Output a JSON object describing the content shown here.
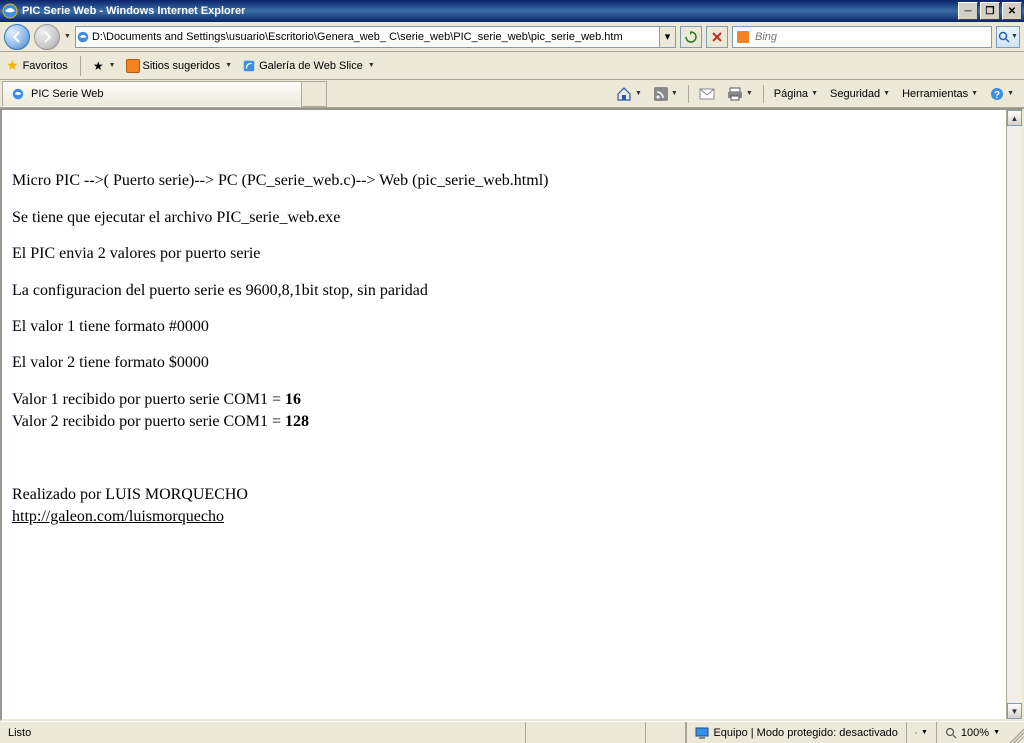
{
  "window": {
    "title": "PIC Serie Web - Windows Internet Explorer"
  },
  "nav": {
    "address": "D:\\Documents and Settings\\usuario\\Escritorio\\Genera_web_ C\\serie_web\\PIC_serie_web\\pic_serie_web.htm",
    "search_placeholder": "Bing"
  },
  "favorites": {
    "label": "Favoritos",
    "suggested": "Sitios sugeridos",
    "webslice": "Galería de Web Slice"
  },
  "tab": {
    "title": "PIC Serie Web"
  },
  "commandbar": {
    "page": "Página",
    "security": "Seguridad",
    "tools": "Herramientas"
  },
  "page": {
    "line1": "Micro PIC -->( Puerto serie)--> PC (PC_serie_web.c)--> Web (pic_serie_web.html)",
    "line2": "Se tiene que ejecutar el archivo PIC_serie_web.exe",
    "line3": "El PIC envia 2 valores por puerto serie",
    "line4": "La configuracion del puerto serie es 9600,8,1bit stop, sin paridad",
    "line5": "El valor 1 tiene formato #0000",
    "line6": "El valor 2 tiene formato $0000",
    "val1_label": "Valor 1 recibido por puerto serie COM1 = ",
    "val1_value": "16",
    "val2_label": "Valor 2 recibido por puerto serie COM1 = ",
    "val2_value": "128",
    "author": "Realizado por LUIS MORQUECHO",
    "link": "http://galeon.com/luismorquecho"
  },
  "status": {
    "ready": "Listo",
    "zone": "Equipo | Modo protegido: desactivado",
    "zoom": "100%"
  }
}
